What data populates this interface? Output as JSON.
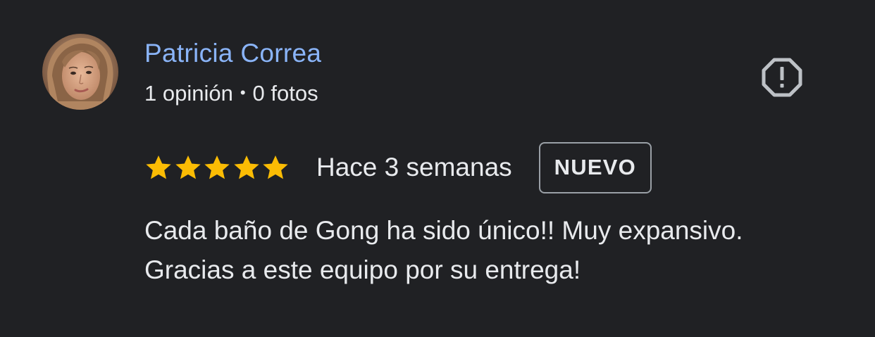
{
  "review": {
    "author": {
      "name": "Patricia Correa",
      "reviews_count": "1 opinión",
      "separator": "•",
      "photos_count": "0 fotos",
      "avatar": "profile-photo"
    },
    "report_icon": "report-octagon-icon",
    "rating": {
      "value": 5,
      "max": 5,
      "star_color": "#fbbc04"
    },
    "time": "Hace 3 semanas",
    "badge": "NUEVO",
    "text_lines": [
      "Cada baño de Gong ha sido único!! Muy expansivo.",
      "Gracias a este equipo por su entrega!"
    ]
  },
  "colors": {
    "background": "#202124",
    "author_name": "#8ab4f8",
    "text": "#e8eaed",
    "icon": "#bdc1c6",
    "badge_border": "#9aa0a6"
  }
}
